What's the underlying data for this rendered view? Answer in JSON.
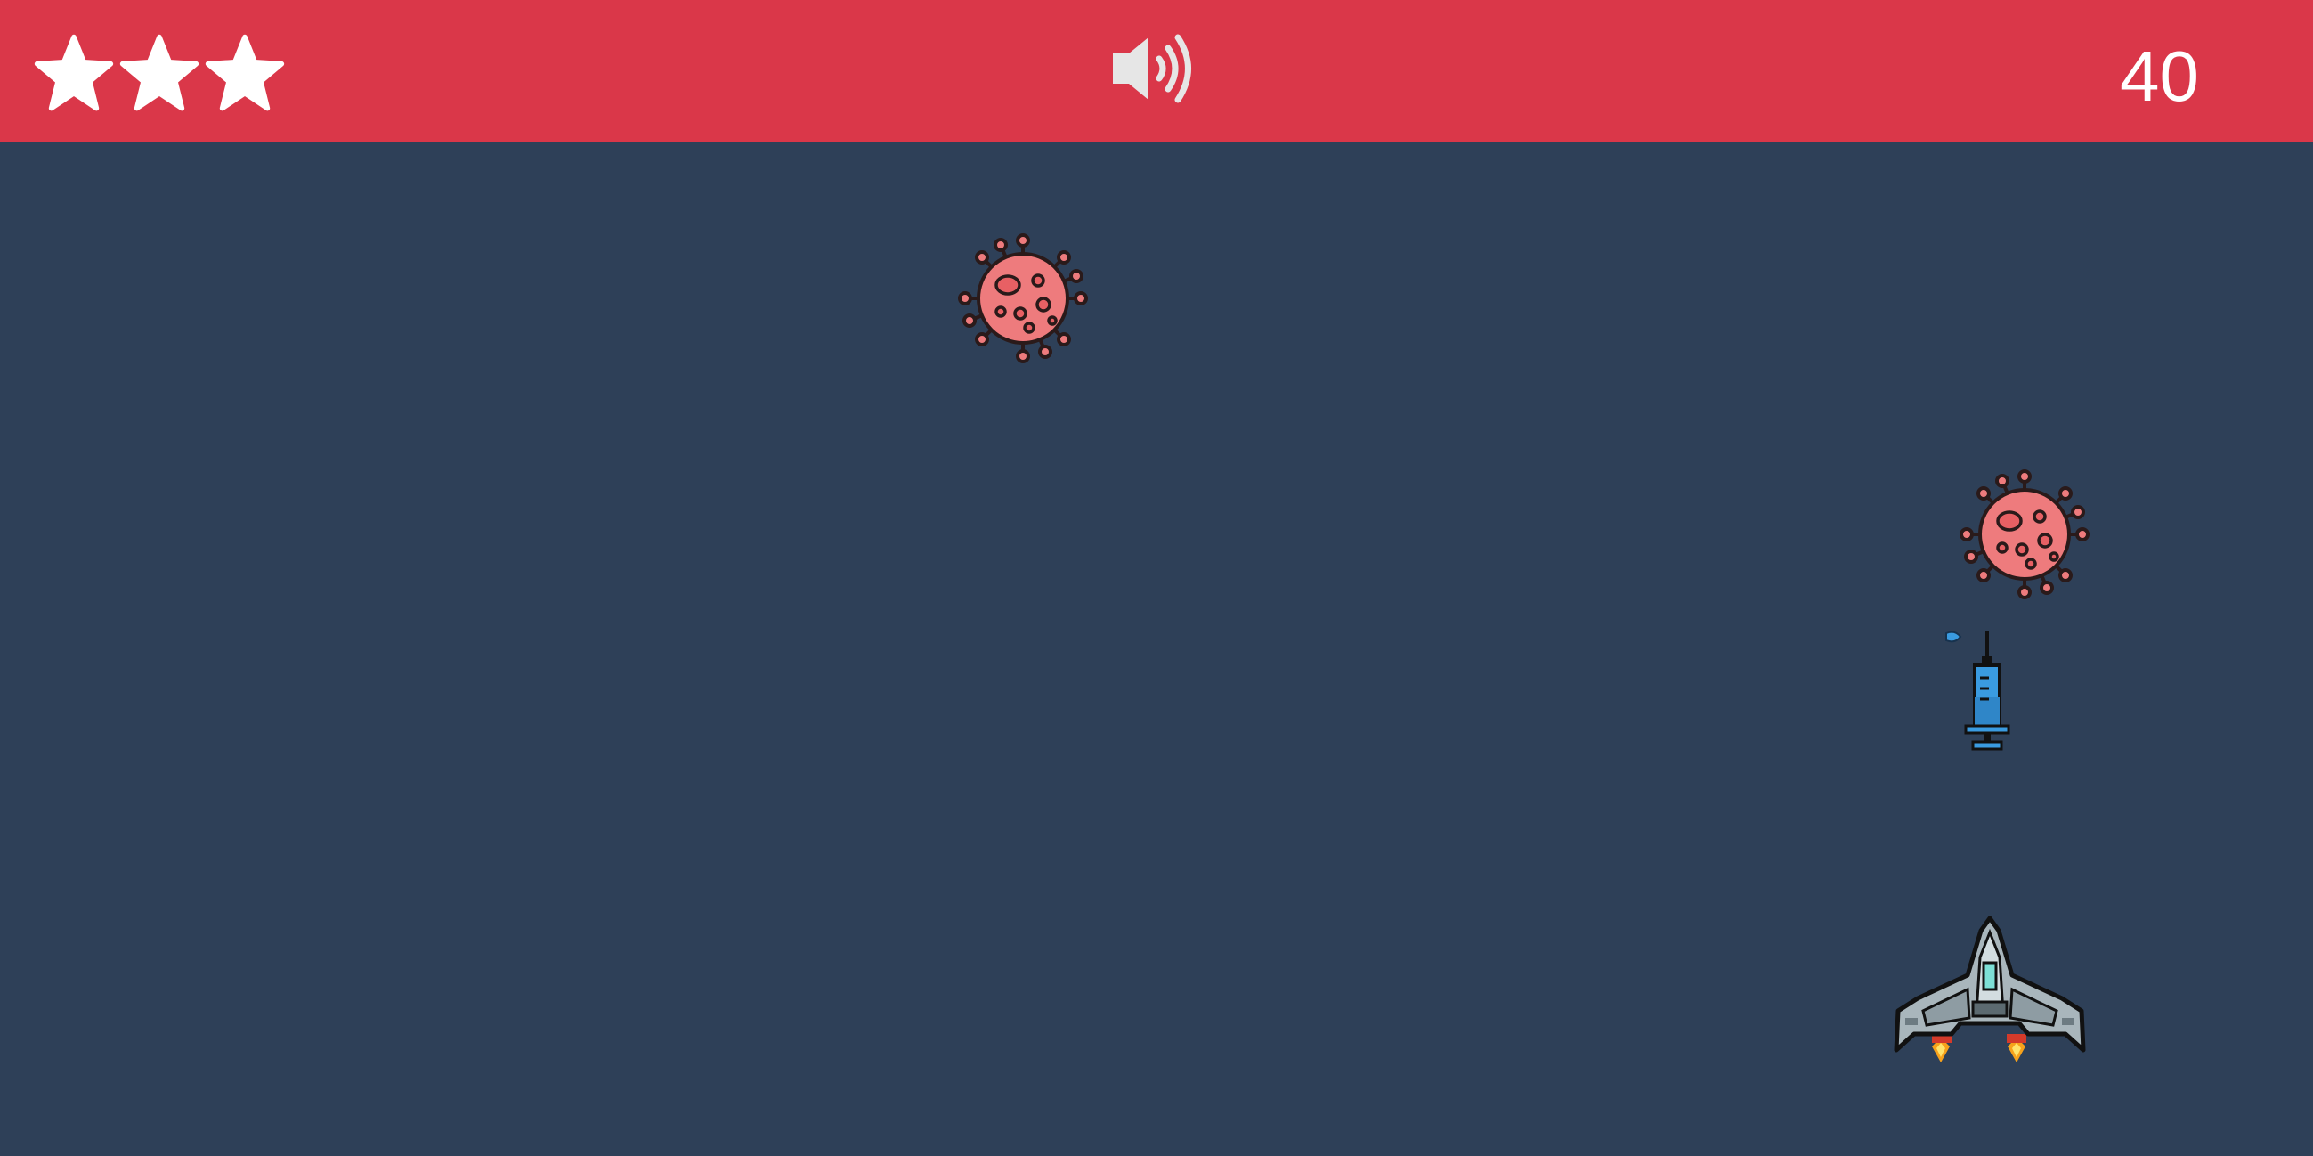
{
  "hud": {
    "background_color": "#da3749",
    "lives": {
      "count": 3,
      "icon": "star-icon",
      "color": "#ffffff"
    },
    "sound": {
      "icon": "speaker-on-icon",
      "state": "on"
    },
    "score": "40"
  },
  "playfield": {
    "background_color": "#2e4058",
    "enemies": [
      {
        "type": "virus",
        "icon": "virus-icon",
        "color": "#ee7b7d"
      },
      {
        "type": "virus",
        "icon": "virus-icon",
        "color": "#ee7b7d"
      }
    ],
    "projectile": {
      "type": "syringe",
      "icon": "syringe-icon",
      "color": "#3a9be0"
    },
    "player": {
      "type": "spaceship",
      "icon": "spaceship-icon"
    }
  }
}
